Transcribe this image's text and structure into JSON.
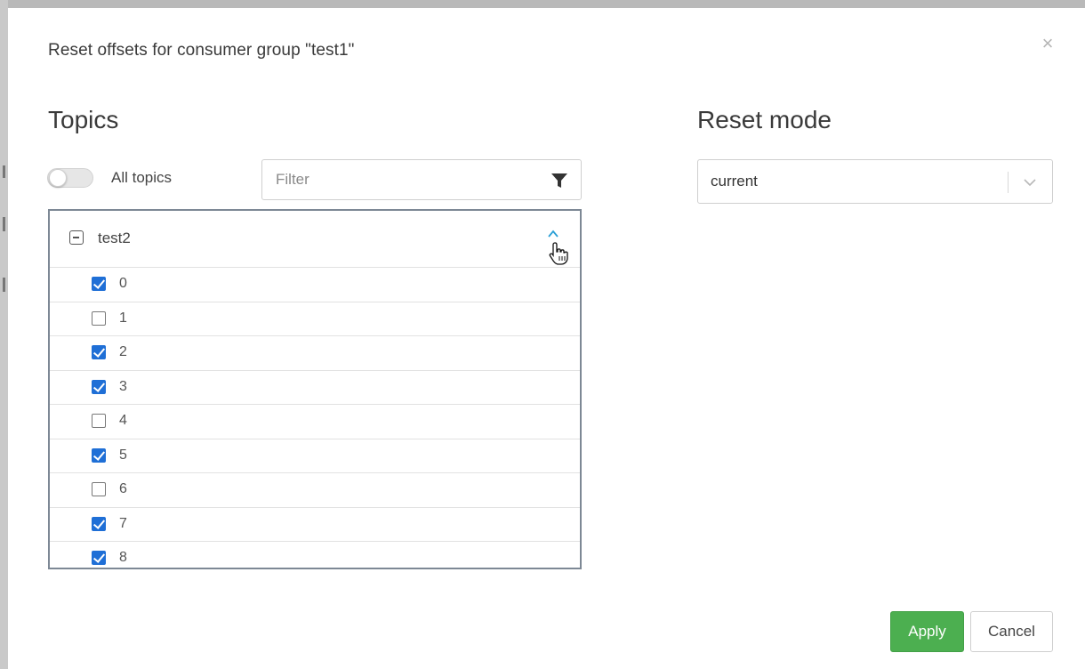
{
  "dialog": {
    "title": "Reset offsets for consumer group \"test1\"",
    "close_glyph": "×"
  },
  "topics": {
    "heading": "Topics",
    "all_topics_toggle": {
      "label": "All topics",
      "on": false
    },
    "filter": {
      "value": "",
      "placeholder": "Filter"
    },
    "tree": {
      "topic": "test2",
      "expanded": true,
      "partitions": [
        {
          "label": "0",
          "checked": true
        },
        {
          "label": "1",
          "checked": false
        },
        {
          "label": "2",
          "checked": true
        },
        {
          "label": "3",
          "checked": true
        },
        {
          "label": "4",
          "checked": false
        },
        {
          "label": "5",
          "checked": true
        },
        {
          "label": "6",
          "checked": false
        },
        {
          "label": "7",
          "checked": true
        },
        {
          "label": "8",
          "checked": true
        }
      ]
    }
  },
  "reset_mode": {
    "heading": "Reset mode",
    "selected": "current"
  },
  "buttons": {
    "apply": "Apply",
    "cancel": "Cancel"
  },
  "colors": {
    "apply_bg": "#4caf50",
    "checkbox_checked": "#1f6fd6",
    "chevron_accent": "#2a9fd6",
    "tree_border": "#7d8895"
  },
  "icons": {
    "close": "close-icon",
    "filter": "filter-icon",
    "select_chevron": "chevron-down-icon",
    "collapse": "minus-square-icon",
    "expand_toggle": "chevron-up-icon",
    "cursor": "hand-cursor-icon"
  }
}
